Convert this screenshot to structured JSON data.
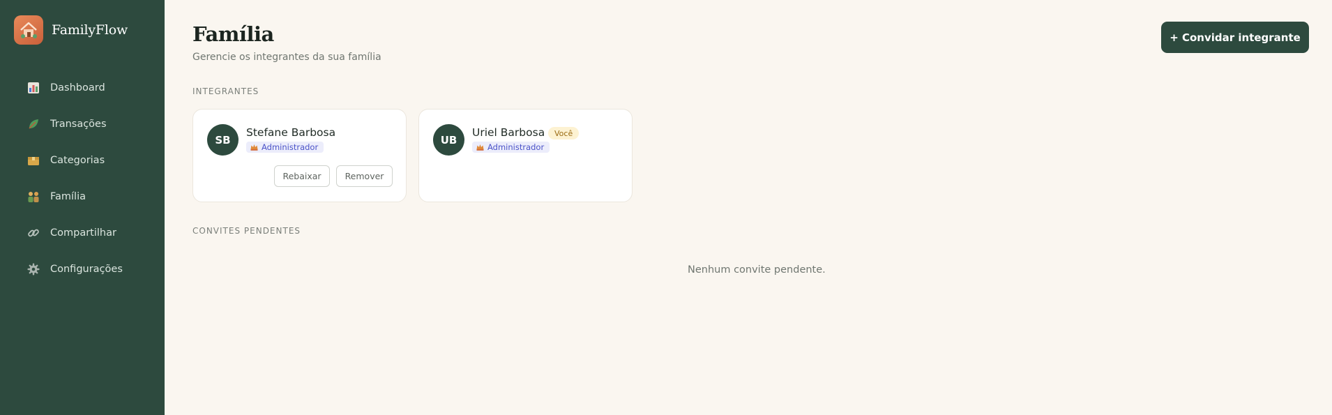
{
  "app": {
    "name": "FamilyFlow",
    "logo_icon": "house-icon"
  },
  "sidebar": {
    "items": [
      {
        "label": "Dashboard",
        "icon": "bar-chart-icon"
      },
      {
        "label": "Transações",
        "icon": "leaf-icon"
      },
      {
        "label": "Categorias",
        "icon": "box-icon"
      },
      {
        "label": "Família",
        "icon": "family-icon"
      },
      {
        "label": "Compartilhar",
        "icon": "link-icon"
      },
      {
        "label": "Configurações",
        "icon": "gear-icon"
      }
    ]
  },
  "header": {
    "title": "Família",
    "subtitle": "Gerencie os integrantes da sua família",
    "invite_label": "+ Convidar integrante"
  },
  "members_section": {
    "label": "INTEGRANTES",
    "members": [
      {
        "initials": "SB",
        "name": "Stefane Barbosa",
        "role": "Administrador",
        "is_you": false,
        "actions": [
          "Rebaixar",
          "Remover"
        ]
      },
      {
        "initials": "UB",
        "name": "Uriel Barbosa",
        "role": "Administrador",
        "is_you": true,
        "you_label": "Você"
      }
    ]
  },
  "invites_section": {
    "label": "CONVITES PENDENTES",
    "empty_message": "Nenhum convite pendente."
  },
  "colors": {
    "sidebar_bg": "#2d4a3e",
    "page_bg": "#faf6f0",
    "accent": "#2d4a3e",
    "role_badge_text": "#4b53c8",
    "you_badge_bg": "#fdf2d2"
  }
}
